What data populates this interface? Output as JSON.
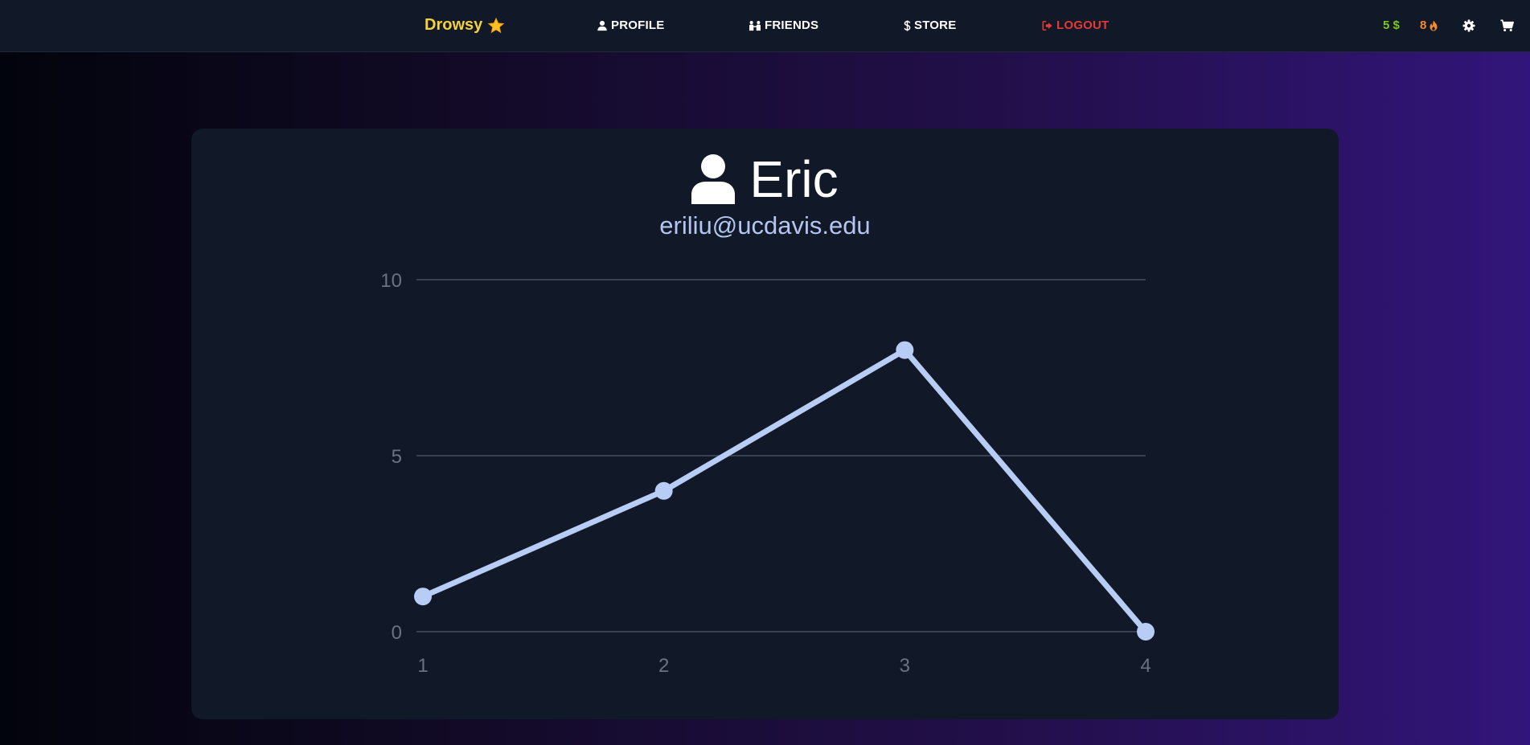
{
  "navbar": {
    "brand": "Drowsy",
    "brand_icon": "star-icon",
    "items": [
      {
        "label": "PROFILE",
        "icon": "user-icon"
      },
      {
        "label": "FRIENDS",
        "icon": "people-icon"
      },
      {
        "label": "STORE",
        "icon": "dollar-icon"
      },
      {
        "label": "LOGOUT",
        "icon": "logout-icon"
      }
    ],
    "money": "5 $",
    "streak": "8",
    "streak_icon": "fire-icon",
    "settings_icon": "gear-icon",
    "cart_icon": "cart-icon"
  },
  "colors": {
    "brand": "#f5d13b",
    "logout": "#e53935",
    "money": "#7bc820",
    "streak": "#f58a2a",
    "line": "#b7cdf5"
  },
  "profile": {
    "name": "Eric",
    "email": "eriliu@ucdavis.edu",
    "avatar_icon": "user-icon"
  },
  "chart_data": {
    "type": "line",
    "x": [
      1,
      2,
      3,
      4
    ],
    "values": [
      1,
      4,
      8,
      0
    ],
    "ylim": [
      0,
      10
    ],
    "yticks": [
      "0",
      "5",
      "10"
    ],
    "xticks": [
      "1",
      "2",
      "3",
      "4"
    ],
    "grid": true,
    "legend": "none"
  }
}
